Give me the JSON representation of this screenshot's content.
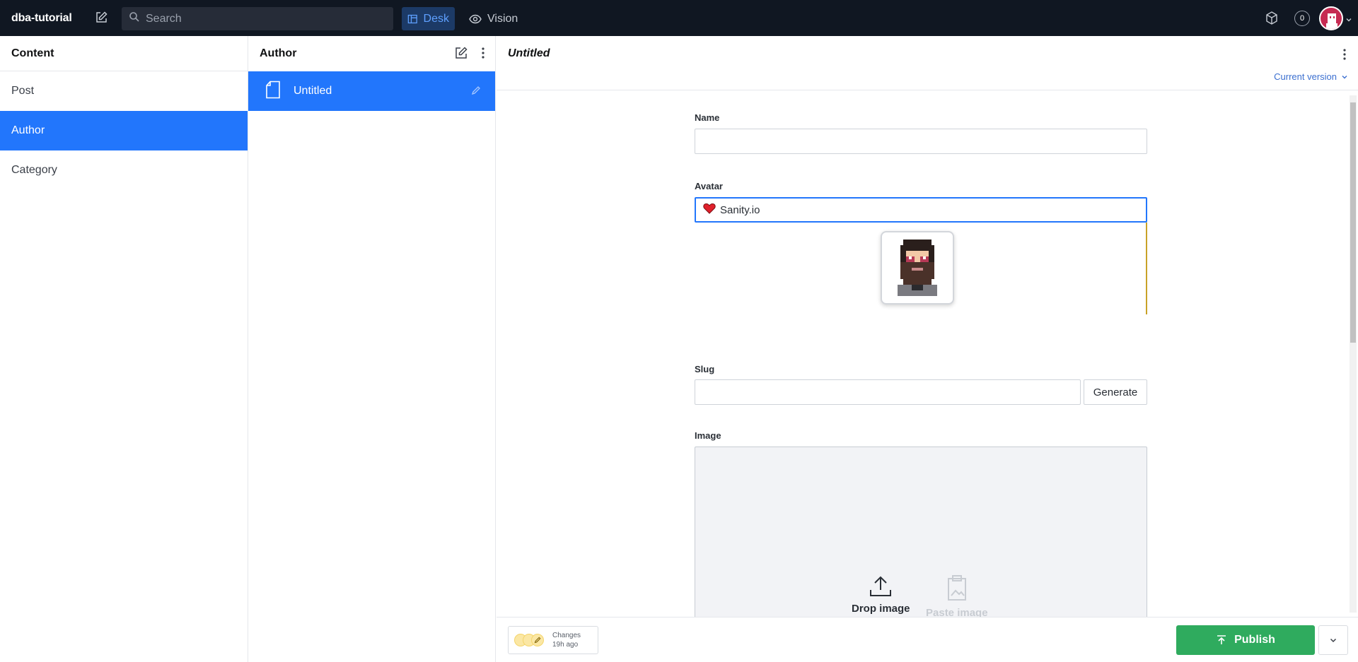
{
  "topbar": {
    "brand": "dba-tutorial",
    "search_placeholder": "Search",
    "tools": [
      {
        "label": "Desk"
      },
      {
        "label": "Vision"
      }
    ],
    "notification_count": "0"
  },
  "content_pane": {
    "title": "Content",
    "items": [
      {
        "label": "Post"
      },
      {
        "label": "Author"
      },
      {
        "label": "Category"
      }
    ]
  },
  "author_pane": {
    "title": "Author",
    "documents": [
      {
        "label": "Untitled"
      }
    ]
  },
  "editor": {
    "title": "Untitled",
    "version_label": "Current version",
    "fields": {
      "name_label": "Name",
      "avatar_label": "Avatar",
      "avatar_value": "Sanity.io",
      "slug_label": "Slug",
      "generate_label": "Generate",
      "image_label": "Image",
      "drop_image_label": "Drop image",
      "paste_image_label": "Paste image"
    },
    "footer": {
      "changes_label": "Changes",
      "changes_time": "19h ago",
      "publish_label": "Publish"
    }
  },
  "colors": {
    "topbar_bg": "#101722",
    "accent": "#2276fc",
    "publish": "#2fab5e"
  }
}
